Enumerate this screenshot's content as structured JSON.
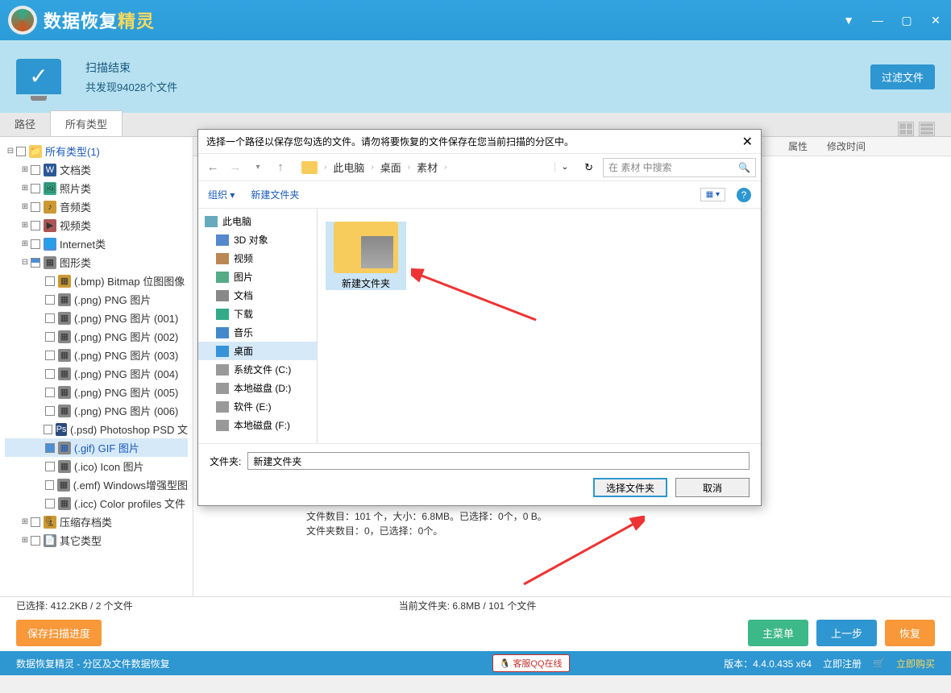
{
  "app": {
    "title_prefix": "数据恢复",
    "title_suffix": "精灵"
  },
  "status": {
    "title": "扫描结束",
    "subtitle": "共发现94028个文件",
    "filter_btn": "过滤文件"
  },
  "tabs": {
    "path": "路径",
    "types": "所有类型"
  },
  "columns": {
    "attr": "属性",
    "modified": "修改时间"
  },
  "tree": {
    "root": "所有类型(1)",
    "docs": "文档类",
    "photos": "照片类",
    "audio": "音频类",
    "video": "视频类",
    "internet": "Internet类",
    "graphics": "图形类",
    "bmp": "(.bmp) Bitmap 位图图像",
    "png": "(.png) PNG 图片",
    "png1": "(.png) PNG 图片 (001)",
    "png2": "(.png) PNG 图片 (002)",
    "png3": "(.png) PNG 图片 (003)",
    "png4": "(.png) PNG 图片 (004)",
    "png5": "(.png) PNG 图片 (005)",
    "png6": "(.png) PNG 图片 (006)",
    "psd": "(.psd) Photoshop PSD 文",
    "gif": "(.gif) GIF 图片",
    "ico": "(.ico) Icon 图片",
    "emf": "(.emf) Windows增强型图",
    "icc": "(.icc) Color profiles 文件",
    "archive": "压缩存档类",
    "other": "其它类型"
  },
  "info": {
    "line2": "文件数目：101 个，大小：6.8MB。已选择：0个，0 B。",
    "line3": "文件夹数目：0，已选择：0个。"
  },
  "status_bar": {
    "selected": "已选择: 412.2KB / 2 个文件",
    "current": "当前文件夹:  6.8MB / 101 个文件"
  },
  "buttons": {
    "save_progress": "保存扫描进度",
    "main_menu": "主菜单",
    "prev": "上一步",
    "recover": "恢复"
  },
  "footer": {
    "left": "数据恢复精灵 - 分区及文件数据恢复",
    "qq": "客服QQ在线",
    "version": "版本：4.4.0.435 x64",
    "register": "立即注册",
    "buy": "立即购买"
  },
  "dialog": {
    "title": "选择一个路径以保存您勾选的文件。请勿将要恢复的文件保存在您当前扫描的分区中。",
    "crumbs": {
      "pc": "此电脑",
      "desktop": "桌面",
      "material": "素材"
    },
    "search_placeholder": "在 素材 中搜索",
    "organize": "组织",
    "new_folder": "新建文件夹",
    "tree": {
      "pc": "此电脑",
      "obj3d": "3D 对象",
      "video": "视频",
      "pic": "图片",
      "doc": "文档",
      "download": "下载",
      "music": "音乐",
      "desktop": "桌面",
      "sysc": "系统文件 (C:)",
      "diskd": "本地磁盘 (D:)",
      "softe": "软件 (E:)",
      "diskf": "本地磁盘 (F:)"
    },
    "file_item": "新建文件夹",
    "folder_label": "文件夹:",
    "folder_value": "新建文件夹",
    "select_btn": "选择文件夹",
    "cancel_btn": "取消"
  }
}
